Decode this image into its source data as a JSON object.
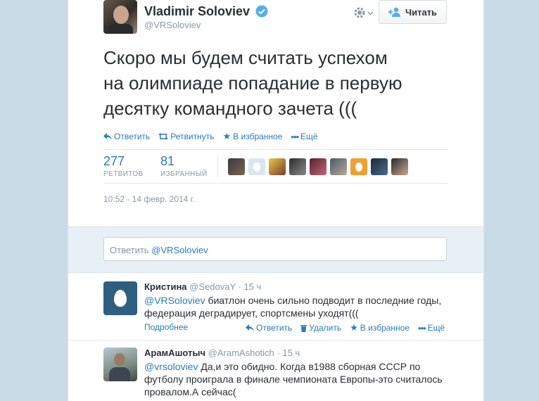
{
  "tweet": {
    "author_name": "Vladimir Soloviev",
    "handle": "@VRSoloviev",
    "follow_label": "Читать",
    "text_line1": "Скоро мы будем считать успехом",
    "text_line2": "на олимпиаде попадание в первую",
    "text_line3": "десятку командного зачета (((",
    "actions": {
      "reply": "Ответить",
      "retweet": "Ретвитнуть",
      "favorite": "В избранное",
      "more": "Ещё"
    },
    "stats": {
      "retweets_count": "277",
      "retweets_label": "РЕТВИТОВ",
      "favorites_count": "81",
      "favorites_label": "ИЗБРАННЫЙ"
    },
    "timestamp": "10:52 - 14 февр. 2014 г."
  },
  "reply_box": {
    "placeholder_prefix": "Ответить ",
    "placeholder_handle": "@VRSoloviev"
  },
  "replies": [
    {
      "name": "Кристина",
      "handle": "@SedovaY",
      "time": "· 15 ч",
      "mention": "@VRSoloviev",
      "text_line1": " биатлон очень сильно подводит в последние годы,",
      "text_line2": "федерация деградирует, спортсмены уходят(((",
      "details": "Подробнее",
      "actions": {
        "reply": "Ответить",
        "delete": "Удалить",
        "favorite": "В избранное",
        "more": "Ещё"
      }
    },
    {
      "name": "АрамАшотыч",
      "handle": "@AramAshotich",
      "time": "· 15 ч",
      "mention": "@vrsoloviev",
      "text_line1": " Да,и это обидно. Когда в1988 сборная СССР по",
      "text_line2": "футболу проиграла в финале чемпионата Европы-это считалось",
      "text_line3": "провалом.А сейчас("
    }
  ],
  "colors": {
    "link": "#2b7bb9",
    "verified": "#55acee",
    "muted": "#8899a6",
    "background": "#c8dbe7"
  }
}
